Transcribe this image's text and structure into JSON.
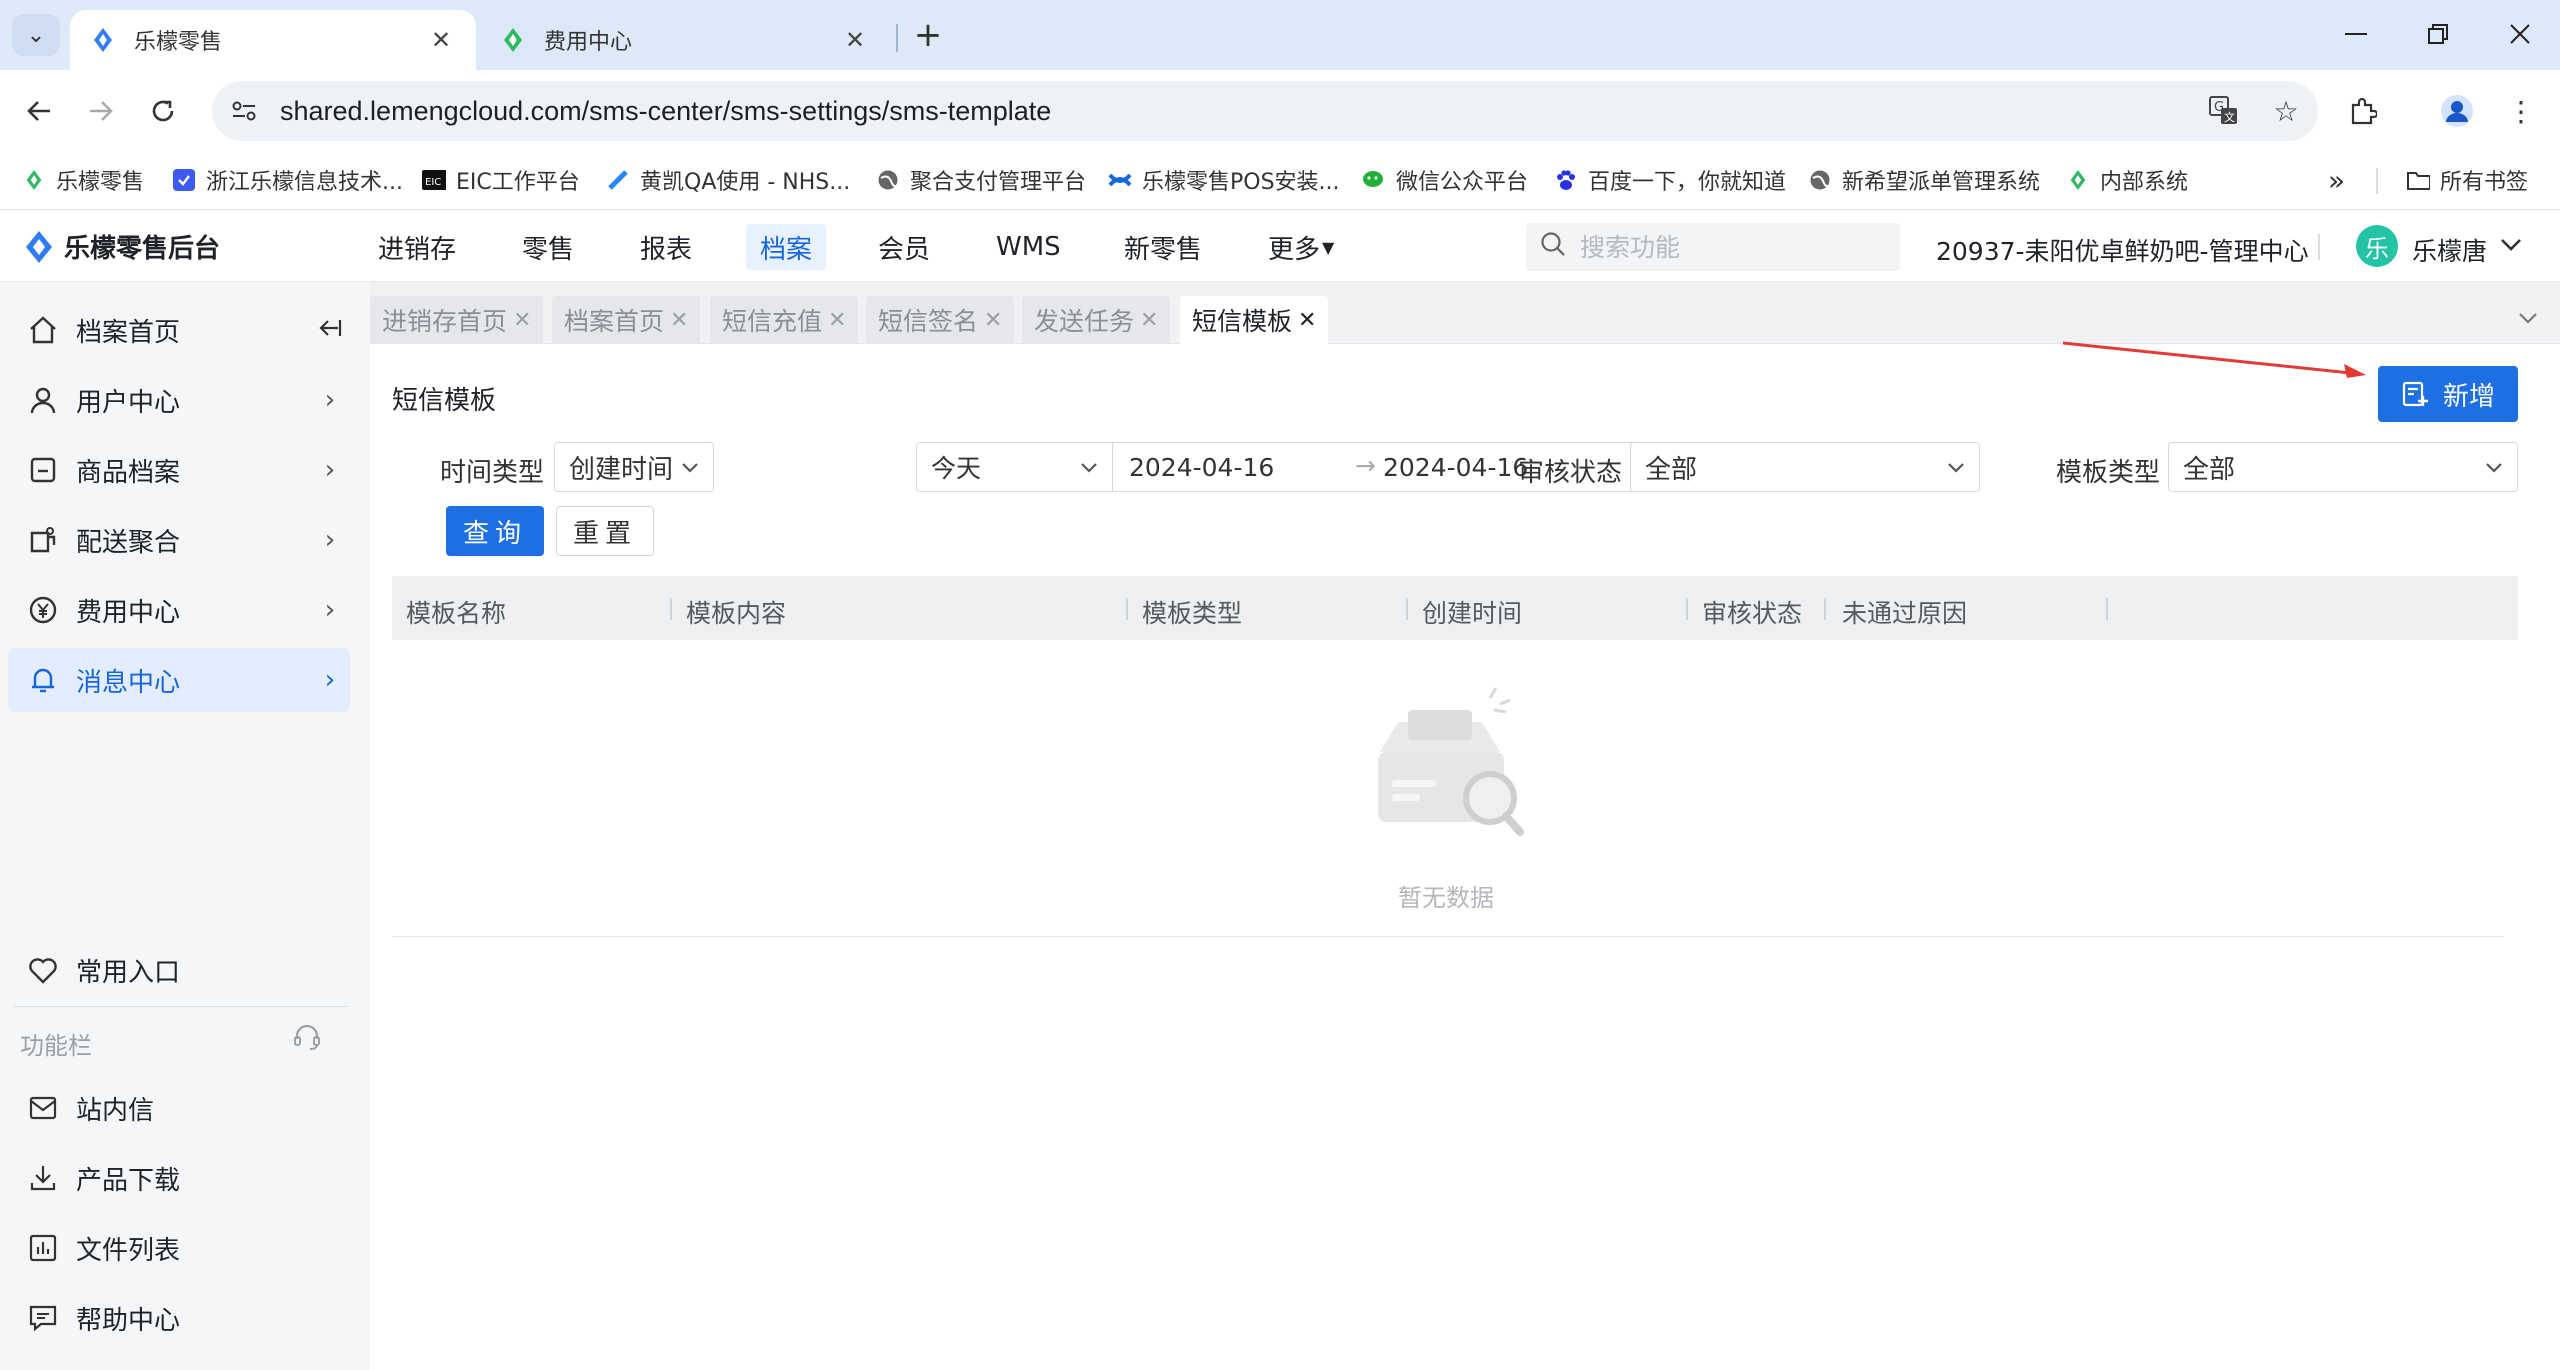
{
  "browser": {
    "tabs": [
      {
        "title": "乐檬零售",
        "close": "✕"
      },
      {
        "title": "费用中心",
        "close": "✕"
      }
    ],
    "url": "shared.lemengcloud.com/sms-center/sms-settings/sms-template",
    "bookmarks": [
      "乐檬零售",
      "浙江乐檬信息技术...",
      "EIC工作平台",
      "黄凯QA使用 - NHS...",
      "聚合支付管理平台",
      "乐檬零售POS安装...",
      "微信公众平台",
      "百度一下，你就知道",
      "新希望派单管理系统",
      "内部系统"
    ],
    "bookmarks_more": "»",
    "all_bookmarks": "所有书签"
  },
  "header": {
    "logo": "乐檬零售后台",
    "nav": [
      "进销存",
      "零售",
      "报表",
      "档案",
      "会员",
      "WMS",
      "新零售",
      "更多"
    ],
    "nav_active": "档案",
    "search_placeholder": "搜索功能",
    "store": "20937-耒阳优卓鲜奶吧-管理中心",
    "avatar_char": "乐",
    "user": "乐檬唐"
  },
  "sidebar": {
    "items": [
      {
        "label": "档案首页",
        "icon": "home-icon"
      },
      {
        "label": "用户中心",
        "icon": "user-icon"
      },
      {
        "label": "商品档案",
        "icon": "goods-icon"
      },
      {
        "label": "配送聚合",
        "icon": "delivery-icon"
      },
      {
        "label": "费用中心",
        "icon": "yen-icon"
      },
      {
        "label": "消息中心",
        "icon": "bell-icon"
      }
    ],
    "active_item": "消息中心",
    "common_entry": "常用入口",
    "func_title": "功能栏",
    "func_items": [
      "站内信",
      "产品下载",
      "文件列表",
      "帮助中心"
    ]
  },
  "page_tabs": [
    "进销存首页",
    "档案首页",
    "短信充值",
    "短信签名",
    "发送任务",
    "短信模板"
  ],
  "page_tabs_active": "短信模板",
  "main": {
    "title": "短信模板",
    "add_button": "新增",
    "filters": {
      "time_type_label": "时间类型",
      "time_type_value": "创建时间",
      "quick_range": "今天",
      "date_start": "2024-04-16",
      "date_sep": "→",
      "date_end": "2024-04-16",
      "audit_label": "审核状态",
      "audit_value": "全部",
      "template_type_label": "模板类型",
      "template_type_value": "全部"
    },
    "query_button": "查询",
    "reset_button": "重置",
    "columns": [
      "模板名称",
      "模板内容",
      "模板类型",
      "创建时间",
      "审核状态",
      "未通过原因"
    ],
    "empty_text": "暂无数据"
  },
  "colors": {
    "primary": "#1d6fe3",
    "active_bg": "#e3edfd",
    "annotation_arrow": "#e53935"
  }
}
